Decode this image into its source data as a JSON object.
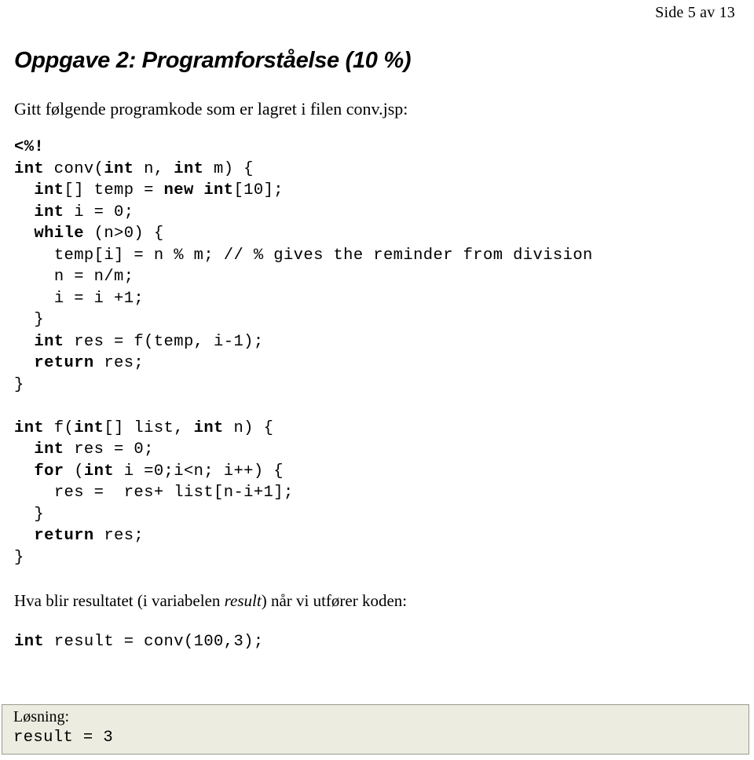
{
  "header": {
    "page_indicator": "Side 5 av 13"
  },
  "document": {
    "title": "Oppgave 2: Programforståelse (10 %)",
    "lead": "Gitt følgende programkode som er lagret i filen conv.jsp:",
    "question_prefix": "Hva blir resultatet (i variabelen ",
    "question_emphasis": "result",
    "question_suffix": ") når vi utfører koden:"
  },
  "code": {
    "language": "jsp",
    "filename": "conv.jsp",
    "lines": [
      {
        "indent": 0,
        "tokens": [
          {
            "text": "<%!",
            "bold": true
          }
        ]
      },
      {
        "indent": 0,
        "tokens": [
          {
            "text": "int",
            "bold": true
          },
          {
            "text": " conv(",
            "bold": false
          },
          {
            "text": "int",
            "bold": true
          },
          {
            "text": " n, ",
            "bold": false
          },
          {
            "text": "int",
            "bold": true
          },
          {
            "text": " m) {",
            "bold": false
          }
        ]
      },
      {
        "indent": 2,
        "tokens": [
          {
            "text": "int",
            "bold": true
          },
          {
            "text": "[] temp = ",
            "bold": false
          },
          {
            "text": "new int",
            "bold": true
          },
          {
            "text": "[10];",
            "bold": false
          }
        ]
      },
      {
        "indent": 2,
        "tokens": [
          {
            "text": "int",
            "bold": true
          },
          {
            "text": " i = 0;",
            "bold": false
          }
        ]
      },
      {
        "indent": 2,
        "tokens": [
          {
            "text": "while",
            "bold": true
          },
          {
            "text": " (n>0) {",
            "bold": false
          }
        ]
      },
      {
        "indent": 4,
        "tokens": [
          {
            "text": "temp[i] = n % m; // % gives the reminder from division",
            "bold": false
          }
        ]
      },
      {
        "indent": 4,
        "tokens": [
          {
            "text": "n = n/m;",
            "bold": false
          }
        ]
      },
      {
        "indent": 4,
        "tokens": [
          {
            "text": "i = i +1;",
            "bold": false
          }
        ]
      },
      {
        "indent": 2,
        "tokens": [
          {
            "text": "}",
            "bold": false
          }
        ]
      },
      {
        "indent": 2,
        "tokens": [
          {
            "text": "int",
            "bold": true
          },
          {
            "text": " res = f(temp, i-1);",
            "bold": false
          }
        ]
      },
      {
        "indent": 2,
        "tokens": [
          {
            "text": "return",
            "bold": true
          },
          {
            "text": " res;",
            "bold": false
          }
        ]
      },
      {
        "indent": 0,
        "tokens": [
          {
            "text": "}",
            "bold": false
          }
        ]
      },
      {
        "indent": 0,
        "tokens": [
          {
            "text": "",
            "bold": false
          }
        ]
      },
      {
        "indent": 0,
        "tokens": [
          {
            "text": "int",
            "bold": true
          },
          {
            "text": " f(",
            "bold": false
          },
          {
            "text": "int",
            "bold": true
          },
          {
            "text": "[] list, ",
            "bold": false
          },
          {
            "text": "int",
            "bold": true
          },
          {
            "text": " n) {",
            "bold": false
          }
        ]
      },
      {
        "indent": 2,
        "tokens": [
          {
            "text": "int",
            "bold": true
          },
          {
            "text": " res = 0;",
            "bold": false
          }
        ]
      },
      {
        "indent": 2,
        "tokens": [
          {
            "text": "for",
            "bold": true
          },
          {
            "text": " (",
            "bold": false
          },
          {
            "text": "int",
            "bold": true
          },
          {
            "text": " i =0;i<n; i++) {",
            "bold": false
          }
        ]
      },
      {
        "indent": 4,
        "tokens": [
          {
            "text": "res =  res+ list[n-i+1];",
            "bold": false
          }
        ]
      },
      {
        "indent": 2,
        "tokens": [
          {
            "text": "}",
            "bold": false
          }
        ]
      },
      {
        "indent": 2,
        "tokens": [
          {
            "text": "return",
            "bold": true
          },
          {
            "text": " res;",
            "bold": false
          }
        ]
      },
      {
        "indent": 0,
        "tokens": [
          {
            "text": "}",
            "bold": false
          }
        ]
      }
    ]
  },
  "call_snippet": {
    "lines": [
      {
        "indent": 0,
        "tokens": [
          {
            "text": "int",
            "bold": true
          },
          {
            "text": " result = conv(100,3);",
            "bold": false
          }
        ]
      }
    ]
  },
  "solution": {
    "label": "Løsning:",
    "value": "result = 3",
    "background_color": "#ecece0",
    "border_color": "#9a9a90"
  }
}
